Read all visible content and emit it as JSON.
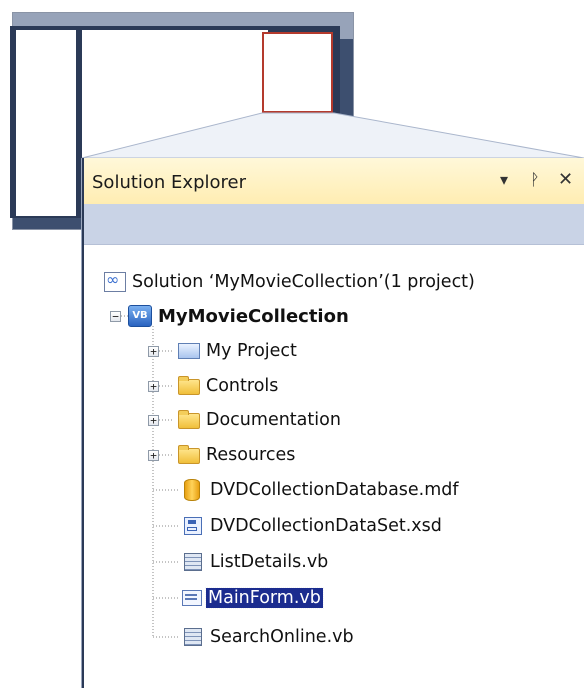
{
  "panel": {
    "title": "Solution Explorer",
    "icons": {
      "dropdown": "▾",
      "pin": "ᚹ",
      "close": "✕"
    }
  },
  "tree": {
    "solution": {
      "label": "Solution ‘MyMovieCollection’(1 project)",
      "icon": "solution-icon"
    },
    "project": {
      "label": "MyMovieCollection",
      "icon": "vb-project-icon",
      "expander": "−",
      "badge": "VB"
    },
    "items": [
      {
        "label": "My Project",
        "icon": "my-project-icon",
        "expander": "+"
      },
      {
        "label": "Controls",
        "icon": "folder-icon",
        "expander": "+"
      },
      {
        "label": "Documentation",
        "icon": "folder-icon",
        "expander": "+"
      },
      {
        "label": "Resources",
        "icon": "folder-icon",
        "expander": "+"
      },
      {
        "label": "DVDCollectionDatabase.mdf",
        "icon": "database-icon"
      },
      {
        "label": "DVDCollectionDataSet.xsd",
        "icon": "dataset-icon"
      },
      {
        "label": "ListDetails.vb",
        "icon": "vb-file-icon"
      },
      {
        "label": "MainForm.vb",
        "icon": "form-icon",
        "selected": true
      },
      {
        "label": "SearchOnline.vb",
        "icon": "vb-file-icon"
      }
    ]
  },
  "colors": {
    "titlebar": "#ffedb2",
    "toolbar": "#c9d3e6",
    "selection": "#1b2c8f",
    "highlight_frame": "#b43a2d",
    "ide_frame": "#2b3a57"
  }
}
